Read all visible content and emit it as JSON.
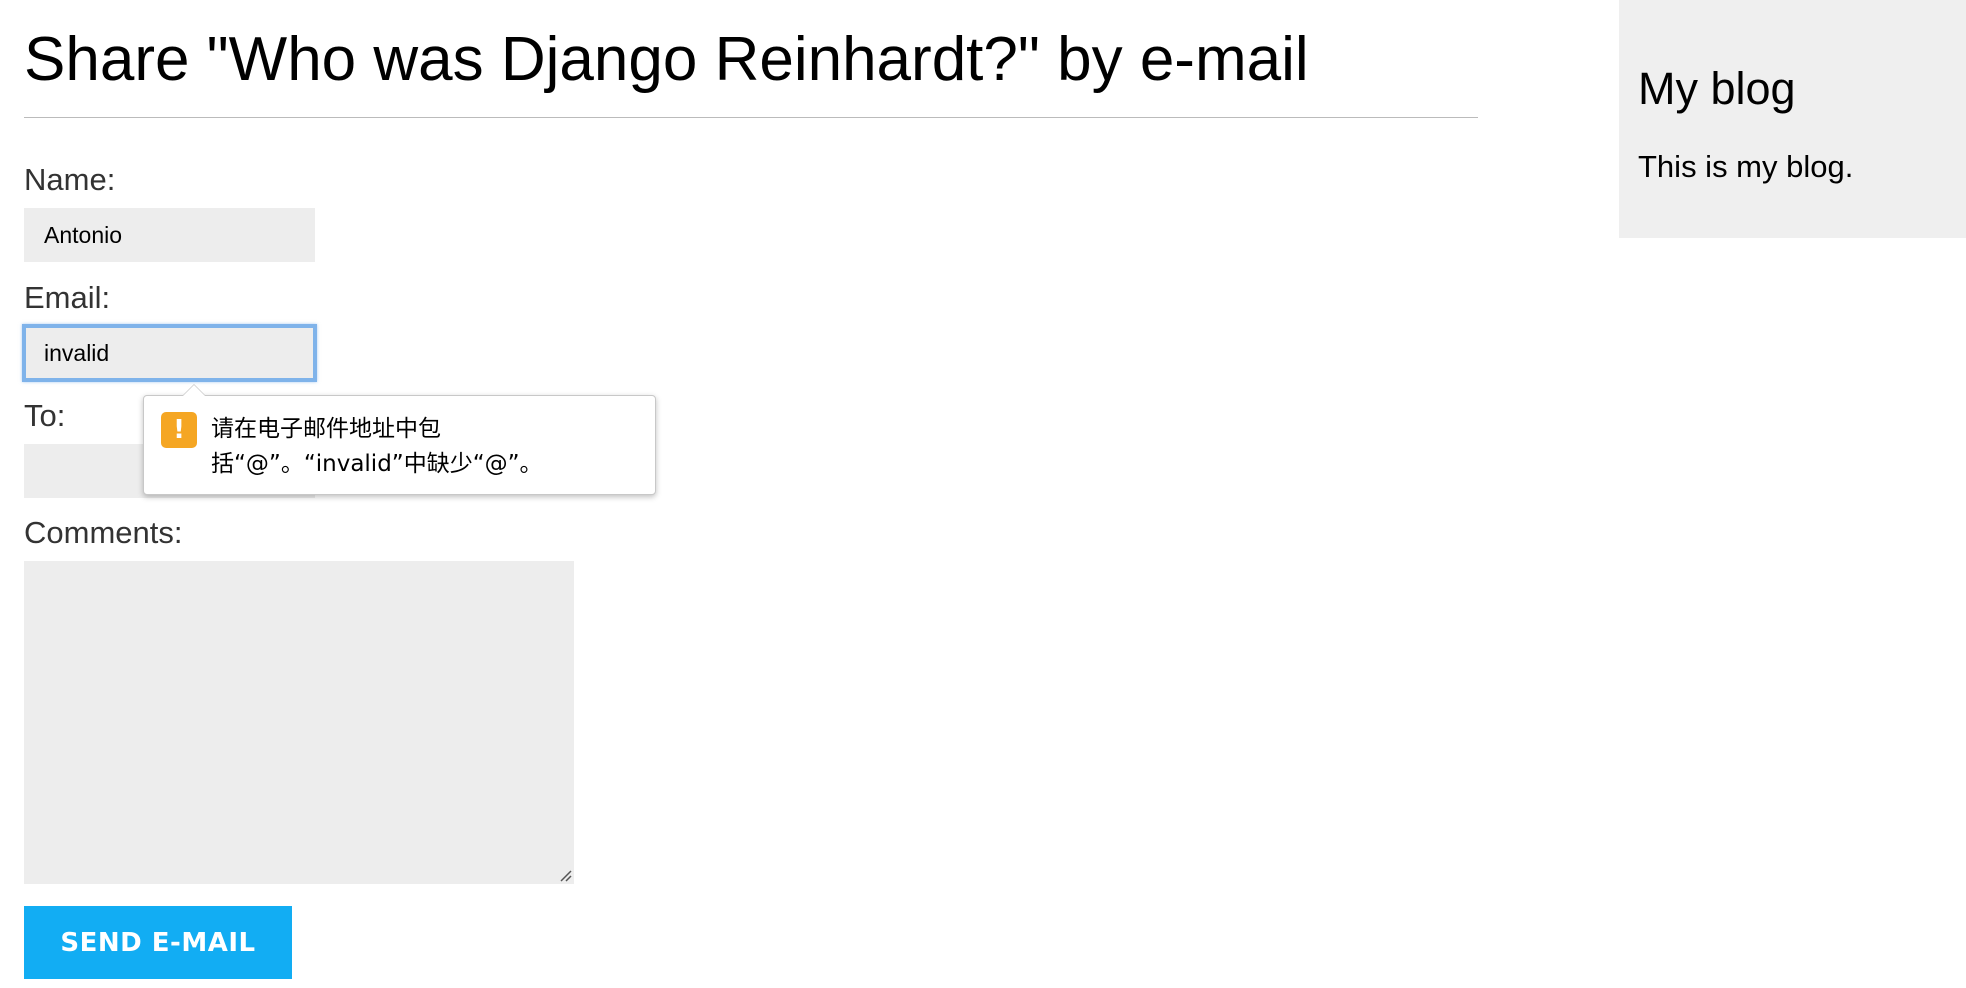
{
  "page": {
    "title": "Share \"Who was Django Reinhardt?\" by e-mail"
  },
  "form": {
    "name_label": "Name:",
    "name_value": "Antonio",
    "email_label": "Email:",
    "email_value": "invalid",
    "to_label": "To:",
    "to_value": "",
    "comments_label": "Comments:",
    "comments_value": "",
    "submit_label": "SEND E-MAIL"
  },
  "validation_tooltip": {
    "icon": "warning-icon",
    "icon_glyph": "!",
    "icon_color": "#f5a623",
    "message": "请在电子邮件地址中包括“@”。“invalid”中缺少“@”。"
  },
  "sidebar": {
    "title": "My blog",
    "text": "This is my blog."
  },
  "colors": {
    "button": "#12adf3",
    "input_background": "#ededed",
    "sidebar_background": "#efefef",
    "focus_ring": "#7fb3ea"
  }
}
